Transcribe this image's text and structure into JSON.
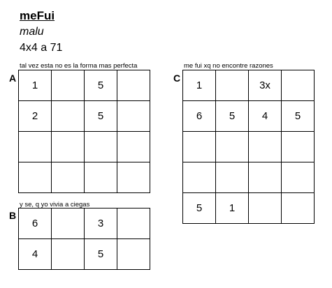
{
  "header": {
    "title": "meFui",
    "author": "malu",
    "subtitle": "4x4 a 71"
  },
  "grids": {
    "A": {
      "label": "A",
      "caption": "tal vez esta no es la forma mas perfecta",
      "cells": [
        [
          "1",
          "",
          "5",
          ""
        ],
        [
          "2",
          "",
          "5",
          ""
        ],
        [
          "",
          "",
          "",
          ""
        ],
        [
          "",
          "",
          "",
          ""
        ]
      ]
    },
    "B": {
      "label": "B",
      "caption": "y se, q yo vivia a ciegas",
      "cells": [
        [
          "6",
          "",
          "3",
          ""
        ],
        [
          "4",
          "",
          "5",
          ""
        ]
      ]
    },
    "C": {
      "label": "C",
      "caption": "me fui xq no encontre razones",
      "cells": [
        [
          "1",
          "",
          "3x",
          ""
        ],
        [
          "6",
          "5",
          "4",
          "5"
        ],
        [
          "",
          "",
          "",
          ""
        ],
        [
          "",
          "",
          "",
          ""
        ],
        [
          "5",
          "1",
          "",
          ""
        ]
      ]
    }
  }
}
